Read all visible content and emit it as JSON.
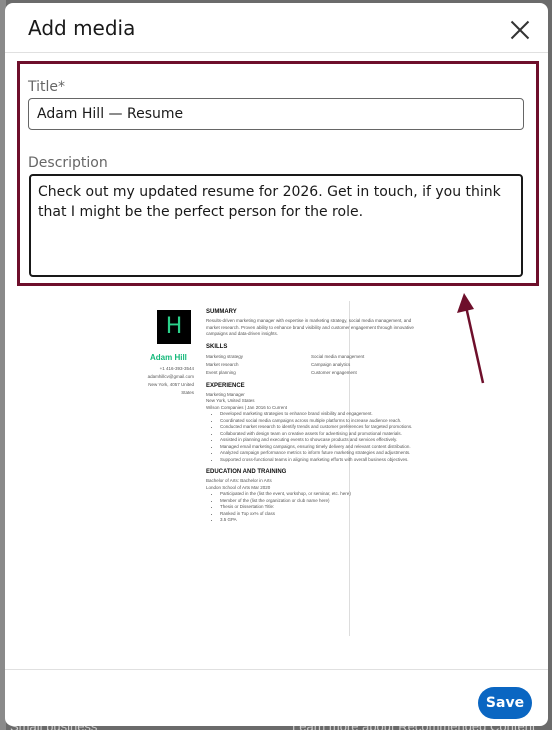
{
  "modal": {
    "title": "Add media",
    "close_icon": "close-icon"
  },
  "form": {
    "title_label": "Title*",
    "title_value": "Adam Hill — Resume",
    "description_label": "Description",
    "description_value": "Check out my updated resume for 2026. Get in touch, if you think that I might be the perfect person for the role."
  },
  "resume_preview": {
    "avatar_letter": "H",
    "name": "Adam Hill",
    "contact": [
      "+1 416-393-3544",
      "adamhillcv@gmail.com",
      "New York, 4057 United",
      "States"
    ],
    "summary_heading": "SUMMARY",
    "summary_text": "Results-driven marketing manager with expertise in marketing strategy, social media management, and market research. Proven ability to enhance brand visibility and customer engagement through innovative campaigns and data-driven insights.",
    "skills_heading": "SKILLS",
    "skills": [
      "Marketing strategy",
      "Social media management",
      "Market research",
      "Campaign analytics",
      "Event planning",
      "Customer engagement"
    ],
    "experience_heading": "EXPERIENCE",
    "experience_title": "Marketing Manager",
    "experience_location": "New York, United States",
    "experience_company": "Wilson Companies | Jan 2016 to Current",
    "experience_bullets": [
      "Developed marketing strategies to enhance brand visibility and engagement.",
      "Coordinated social media campaigns across multiple platforms to increase audience reach.",
      "Conducted market research to identify trends and customer preferences for targeted promotions.",
      "Collaborated with design team on creative assets for advertising and promotional materials.",
      "Assisted in planning and executing events to showcase products and services effectively.",
      "Managed email marketing campaigns, ensuring timely delivery and relevant content distribution.",
      "Analyzed campaign performance metrics to inform future marketing strategies and adjustments.",
      "Supported cross-functional teams in aligning marketing efforts with overall business objectives."
    ],
    "education_heading": "EDUCATION AND TRAINING",
    "education_degree": "Bachelor of Arts: Bachelor in Arts",
    "education_school": "London School of Arts Mar 2020",
    "education_bullets": [
      "Participated in the (list the event, workshop, or seminar, etc. here)",
      "Member of the (list the organization or club name here)",
      "Thesis or Dissertation Title:",
      "Ranked in Top xx% of class",
      "3.5 GPA"
    ]
  },
  "footer": {
    "save_label": "Save"
  },
  "background": {
    "left_text": "Small business",
    "right_text": "Learn more about Recommended Content"
  },
  "colors": {
    "accent": "#0a66c2",
    "highlight_border": "#6e0f2b",
    "resume_green": "#13b97a"
  }
}
